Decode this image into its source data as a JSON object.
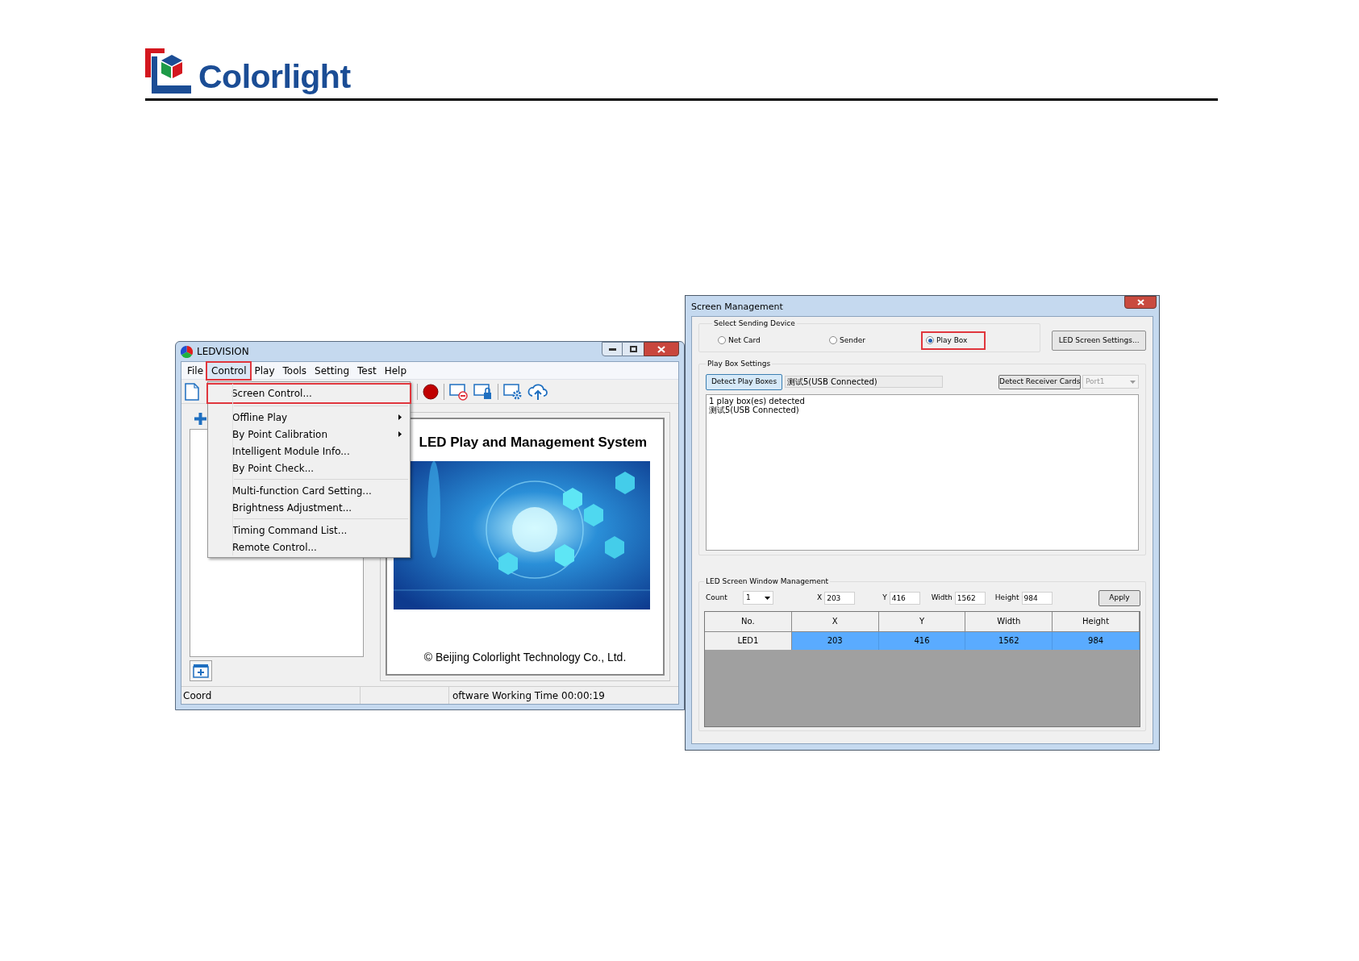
{
  "logo": {
    "text": "Colorlight"
  },
  "ledvision": {
    "title": "LEDVISION",
    "menu": [
      {
        "label": "File",
        "selected": false
      },
      {
        "label": "Control",
        "selected": true
      },
      {
        "label": "Play",
        "selected": false
      },
      {
        "label": "Tools",
        "selected": false
      },
      {
        "label": "Setting",
        "selected": false
      },
      {
        "label": "Test",
        "selected": false
      },
      {
        "label": "Help",
        "selected": false
      }
    ],
    "dropdown": [
      [
        {
          "label": "Screen Control...",
          "has_submenu": false,
          "highlighted": true
        }
      ],
      [
        {
          "label": "Offline Play",
          "has_submenu": true,
          "highlighted": false
        },
        {
          "label": "By Point Calibration",
          "has_submenu": true,
          "highlighted": false
        },
        {
          "label": "Intelligent Module Info...",
          "has_submenu": false,
          "highlighted": false
        },
        {
          "label": "By Point Check...",
          "has_submenu": false,
          "highlighted": false
        }
      ],
      [
        {
          "label": "Multi-function Card Setting...",
          "has_submenu": false,
          "highlighted": false
        },
        {
          "label": "Brightness Adjustment...",
          "has_submenu": false,
          "highlighted": false
        }
      ],
      [
        {
          "label": "Timing Command List...",
          "has_submenu": false,
          "highlighted": false
        },
        {
          "label": "Remote Control...",
          "has_submenu": false,
          "highlighted": false
        }
      ]
    ],
    "preview": {
      "title": "LED Play and Management System",
      "copyright": "© Beijing Colorlight Technology Co., Ltd."
    },
    "status_bar": {
      "left": "Coord",
      "right": "oftware Working Time 00:00:19"
    }
  },
  "screen_management": {
    "title": "Screen Management",
    "sending_device": {
      "label": "Select Sending Device",
      "options": [
        {
          "label": "Net Card",
          "selected": false,
          "highlighted": false
        },
        {
          "label": "Sender",
          "selected": false,
          "highlighted": false
        },
        {
          "label": "Play Box",
          "selected": true,
          "highlighted": true
        }
      ],
      "settings_button": "LED Screen Settings..."
    },
    "play_box_settings": {
      "label": "Play Box Settings",
      "detect_button": "Detect Play Boxes",
      "device_field": "测试5(USB Connected)",
      "receiver_button": "Detect Receiver Cards",
      "port": "Port1",
      "log": [
        "1 play box(es) detected",
        "测试5(USB Connected)"
      ]
    },
    "window_management": {
      "label": "LED Screen Window Management",
      "count_label": "Count",
      "count": "1",
      "fields": [
        {
          "label": "X",
          "value": "203"
        },
        {
          "label": "Y",
          "value": "416"
        },
        {
          "label": "Width",
          "value": "1562"
        },
        {
          "label": "Height",
          "value": "984"
        }
      ],
      "apply_button": "Apply",
      "table": {
        "columns": [
          "No.",
          "X",
          "Y",
          "Width",
          "Height"
        ],
        "rows": [
          {
            "cells": [
              "LED1",
              "203",
              "416",
              "1562",
              "984"
            ],
            "selected": true
          }
        ]
      }
    }
  }
}
